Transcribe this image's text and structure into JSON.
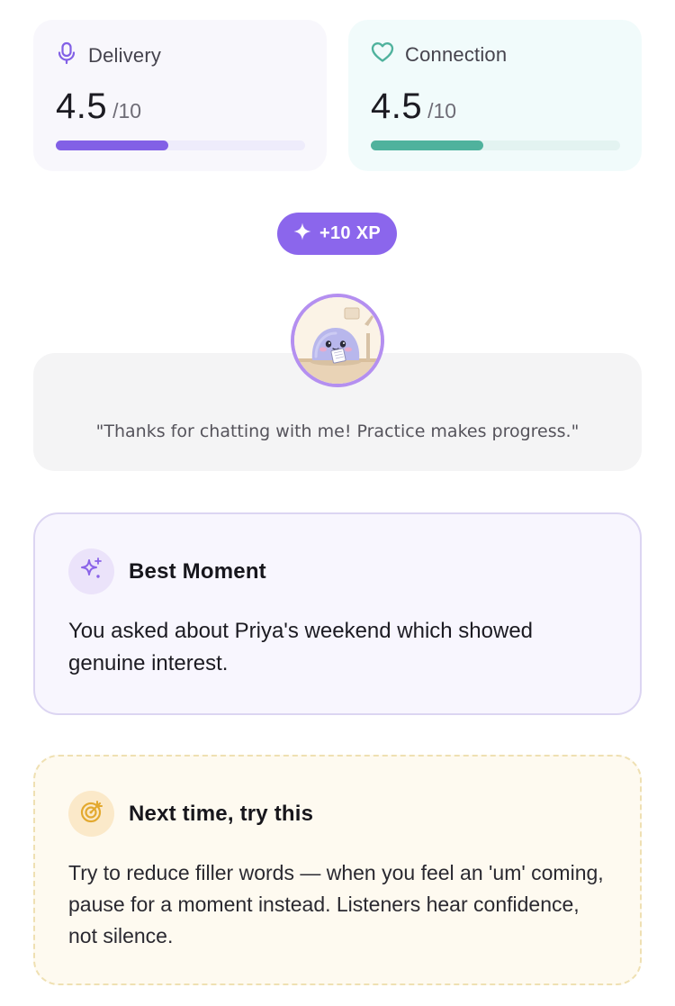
{
  "scores": {
    "delivery": {
      "label": "Delivery",
      "value": "4.5",
      "max": "/10",
      "progress": 0.45,
      "icon": "microphone-icon",
      "color": "#8260e6"
    },
    "connection": {
      "label": "Connection",
      "value": "4.5",
      "max": "/10",
      "progress": 0.45,
      "icon": "heart-icon",
      "color": "#4fb29d"
    }
  },
  "xp": {
    "label": "+10 XP",
    "icon": "sparkle-icon"
  },
  "coach": {
    "avatar": "coach-character",
    "quote": "\"Thanks for chatting with me! Practice makes progress.\""
  },
  "best_moment": {
    "title": "Best Moment",
    "icon": "sparkles-icon",
    "text": "You asked about Priya's weekend which showed genuine interest."
  },
  "next_time": {
    "title": "Next time, try this",
    "icon": "target-icon",
    "text": "Try to reduce filler words — when you feel an 'um' coming, pause for a moment instead. Listeners hear confidence, not silence."
  }
}
